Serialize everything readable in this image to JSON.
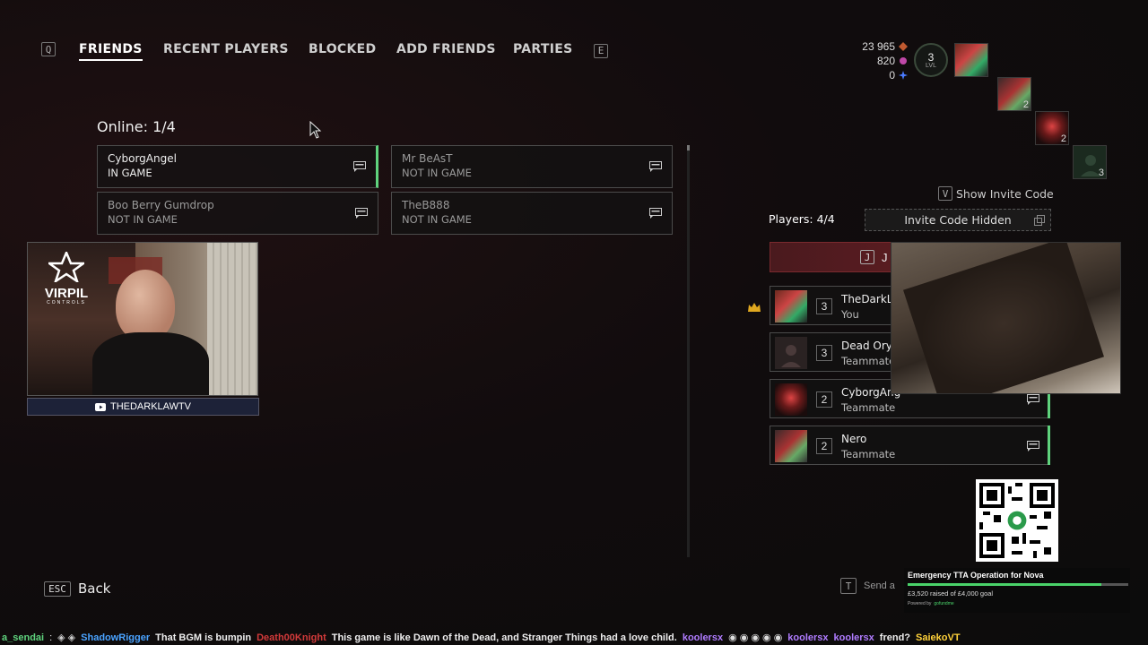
{
  "nav": {
    "left_key": "Q",
    "right_key": "E",
    "tabs": [
      {
        "label": "FRIENDS",
        "active": true
      },
      {
        "label": "RECENT PLAYERS",
        "active": false
      },
      {
        "label": "BLOCKED",
        "active": false
      },
      {
        "label": "ADD FRIENDS",
        "active": false
      },
      {
        "label": "PARTIES",
        "active": false
      }
    ]
  },
  "currency": {
    "a": "23 965",
    "b": "820",
    "c": "0"
  },
  "level": {
    "value": "3",
    "label": "LVL"
  },
  "party_slots": [
    {
      "num": ""
    },
    {
      "num": "2"
    },
    {
      "num": "2"
    },
    {
      "num": "3"
    }
  ],
  "friends": {
    "online_label": "Online: 1/4",
    "list": [
      {
        "name": "CyborgAngel",
        "status": "IN GAME"
      },
      {
        "name": "Mr BeAsT",
        "status": "NOT IN GAME"
      },
      {
        "name": "Boo Berry Gumdrop",
        "status": "NOT IN GAME"
      },
      {
        "name": "TheB888",
        "status": "NOT IN GAME"
      }
    ]
  },
  "webcam": {
    "badge": "THEDARKLAWTV",
    "logo": "VIRPIL",
    "logo_sub": "CONTROLS"
  },
  "party": {
    "show_invite_key": "V",
    "show_invite_label": "Show Invite Code",
    "players_label": "Players: 4/4",
    "invite_code_label": "Invite Code Hidden",
    "join_key": "J",
    "join_label": "J",
    "members": [
      {
        "name": "TheDarkLa",
        "level": "3",
        "role": "You"
      },
      {
        "name": "Dead Oryx",
        "level": "3",
        "role": "Teammate"
      },
      {
        "name": "CyborgAng",
        "level": "2",
        "role": "Teammate"
      },
      {
        "name": "Nero",
        "level": "2",
        "role": "Teammate"
      }
    ]
  },
  "back": {
    "key": "ESC",
    "label": "Back"
  },
  "send": {
    "key": "T",
    "placeholder": "Send a"
  },
  "donation": {
    "title": "Emergency TTA Operation for Nova",
    "raised": "£3,520 raised of £4,000 goal",
    "progress": 0.88,
    "powered": "Powered by",
    "brand": "gofundme"
  },
  "chat": [
    {
      "user": "a_sendai",
      "msg": "",
      "color": "#5fd37d"
    },
    {
      "user": "ShadowRigger",
      "msg": "That BGM is bumpin",
      "color": "#4aa3ff"
    },
    {
      "user": "Death00Knight",
      "msg": "This game is like Dawn of the Dead, and Stranger Things had a love child.",
      "color": "#d33a3a"
    },
    {
      "user": "koolersx",
      "msg": "",
      "color": "#b07cff"
    },
    {
      "user": "koolersx",
      "msg": "",
      "color": "#b07cff"
    },
    {
      "user": "koolersx",
      "msg": "frend?",
      "color": "#b07cff"
    },
    {
      "user": "SaiekoVT",
      "msg": "",
      "color": "#ffd23a"
    }
  ]
}
